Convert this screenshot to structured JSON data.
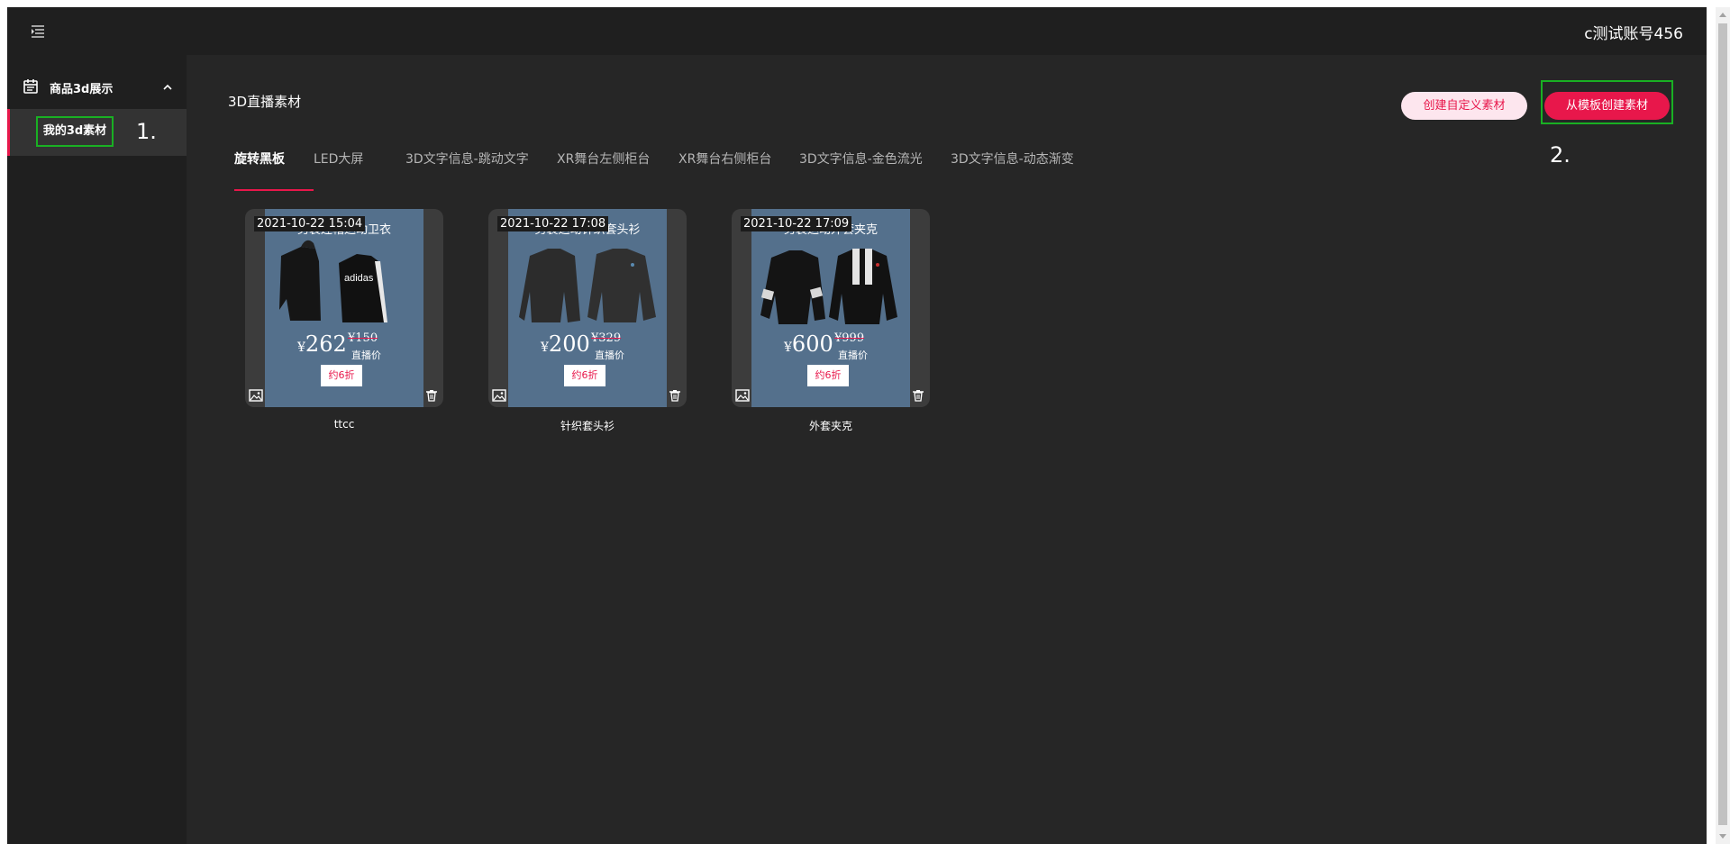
{
  "header": {
    "menu_icon": "menu-fold-icon",
    "account": "c测试账号456"
  },
  "sidebar": {
    "group": {
      "icon": "calendar-icon",
      "label": "商品3d展示",
      "expanded": true
    },
    "items": [
      {
        "label": "我的3d素材",
        "annotation": "1.",
        "active": true
      }
    ]
  },
  "main": {
    "title": "3D直播素材",
    "buttons": {
      "custom": "创建自定义素材",
      "template": "从模板创建素材",
      "template_annotation": "2."
    },
    "tabs": [
      {
        "label": "旋转黑板",
        "active": true
      },
      {
        "label": "LED大屏"
      },
      {
        "label": "3D文字信息-跳动文字"
      },
      {
        "label": "XR舞台左侧柜台"
      },
      {
        "label": "XR舞台右侧柜台"
      },
      {
        "label": "3D文字信息-金色流光"
      },
      {
        "label": "3D文字信息-动态渐变"
      }
    ],
    "cards": [
      {
        "name": "ttcc",
        "date": "2021-10-22 15:04",
        "poster": {
          "title": "男装连帽运动卫衣",
          "currency": "¥",
          "price": "262",
          "old_price": "¥150",
          "price_label": "直播价",
          "discount": "约6折",
          "product": "hoodie"
        }
      },
      {
        "name": "针织套头衫",
        "date": "2021-10-22 17:08",
        "poster": {
          "title": "男装运动针织套头衫",
          "currency": "¥",
          "price": "200",
          "old_price": "¥329",
          "price_label": "直播价",
          "discount": "约6折",
          "product": "sweater"
        }
      },
      {
        "name": "外套夹克",
        "date": "2021-10-22 17:09",
        "poster": {
          "title": "男装运动外套夹克",
          "currency": "¥",
          "price": "600",
          "old_price": "¥999",
          "price_label": "直播价",
          "discount": "约6折",
          "product": "jacket"
        }
      }
    ]
  },
  "colors": {
    "accent": "#e8174b",
    "accent_light": "#fde6ee",
    "annotation_box": "#19b023",
    "header_bg": "#1f1f1f",
    "content_bg": "#262626",
    "poster_bg": "#54708c"
  }
}
